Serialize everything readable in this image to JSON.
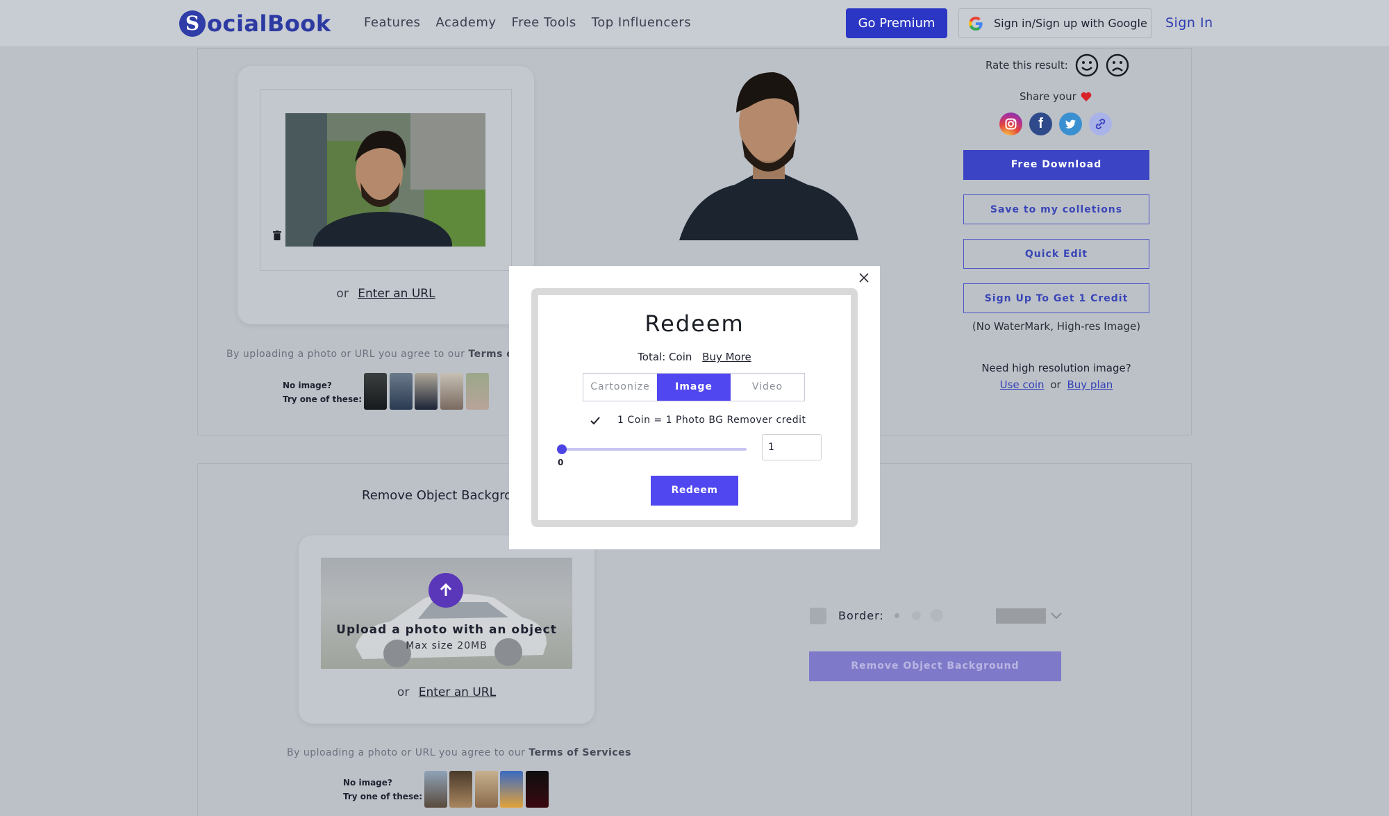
{
  "header": {
    "logo_letter": "S",
    "logo_text": "ocialBook",
    "nav": [
      "Features",
      "Academy",
      "Free Tools",
      "Top Influencers"
    ],
    "premium_label": "Go Premium",
    "google_label": "Sign in/Sign up with Google",
    "signin_label": "Sign In"
  },
  "upload_panel": {
    "or_text": "or",
    "url_link": "Enter an URL",
    "terms_prefix": "By uploading a photo or URL you agree to our",
    "terms_link": "Terms of Se",
    "no_image": "No image?",
    "try_these": "Try one of these:"
  },
  "result_panel": {
    "rate_label": "Rate this result:",
    "share_label": "Share your",
    "free_download": "Free Download",
    "save_collections": "Save to my colletions",
    "quick_edit": "Quick Edit",
    "sign_up_credit": "Sign Up To Get 1 Credit",
    "no_watermark": "(No WaterMark, High-res Image)",
    "need_high_res": "Need high resolution image?",
    "use_coin": "Use coin",
    "or_text": "or",
    "buy_plan": "Buy plan"
  },
  "object_panel": {
    "title": "Remove Object Backgrou",
    "upload_title": "Upload a photo with an object",
    "max_size": "Max size 20MB",
    "or_text": "or",
    "url_link": "Enter an URL",
    "terms_prefix": "By uploading a photo or URL you agree to our",
    "terms_link": "Terms of Services",
    "no_image": "No image?",
    "try_these": "Try one of these:",
    "border_label": "Border:",
    "remove_button": "Remove Object Background"
  },
  "modal": {
    "title": "Redeem",
    "total_label": "Total: Coin",
    "buy_more": "Buy More",
    "tabs": [
      "Cartoonize",
      "Image",
      "Video"
    ],
    "active_tab": "Image",
    "credit_note": "1 Coin = 1 Photo BG Remover credit",
    "slider_min": "0",
    "slider_level": 0,
    "quantity_value": "1",
    "redeem_button": "Redeem"
  },
  "colors": {
    "brand": "#2b37c4",
    "accent_purple": "#5147f0",
    "overlay_bg": "#bcc1c8"
  }
}
